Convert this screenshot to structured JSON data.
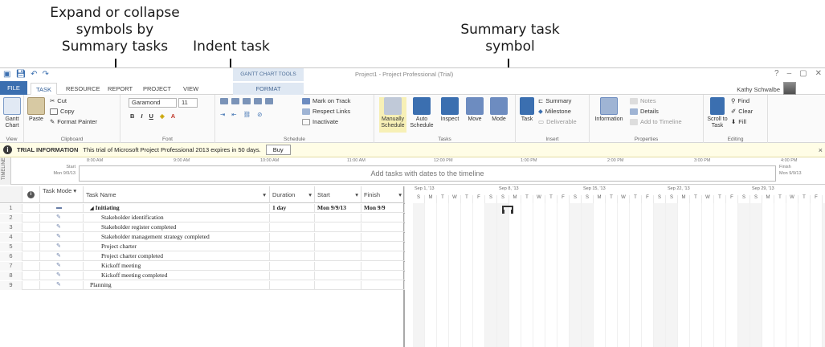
{
  "callouts": {
    "expand": "Expand or collapse\nsymbols by\nSummary tasks",
    "indent": "Indent task",
    "summary": "Summary task\nsymbol"
  },
  "window": {
    "context_tab_group": "GANTT CHART TOOLS",
    "doc_title": "Project1 - Project Professional (Trial)",
    "controls": [
      "?",
      "–",
      "▢",
      "✕"
    ]
  },
  "tabs": [
    "FILE",
    "TASK",
    "RESOURCE",
    "REPORT",
    "PROJECT",
    "VIEW",
    "FORMAT"
  ],
  "active_tab": "TASK",
  "user": "Kathy Schwalbe",
  "ribbon": {
    "view": {
      "btn": "Gantt Chart",
      "label": "View"
    },
    "clipboard": {
      "paste": "Paste",
      "cut": "Cut",
      "copy": "Copy",
      "format_painter": "Format Painter",
      "label": "Clipboard"
    },
    "font": {
      "family": "Garamond",
      "size": "11",
      "label": "Font"
    },
    "schedule": {
      "mark_on_track": "Mark on Track",
      "respect_links": "Respect Links",
      "inactivate": "Inactivate",
      "label": "Schedule"
    },
    "tasks": {
      "manually": "Manually Schedule",
      "auto": "Auto Schedule",
      "inspect": "Inspect",
      "move": "Move",
      "mode": "Mode",
      "label": "Tasks"
    },
    "insert": {
      "task": "Task",
      "summary": "Summary",
      "milestone": "Milestone",
      "deliverable": "Deliverable",
      "label": "Insert"
    },
    "properties": {
      "information": "Information",
      "notes": "Notes",
      "details": "Details",
      "add_to_timeline": "Add to Timeline",
      "label": "Properties"
    },
    "editing": {
      "scroll": "Scroll to Task",
      "find": "Find",
      "clear": "Clear",
      "fill": "Fill",
      "label": "Editing"
    }
  },
  "infobar": {
    "title": "TRIAL INFORMATION",
    "message": "This trial of Microsoft Project Professional 2013 expires in 50 days.",
    "button": "Buy"
  },
  "timeline": {
    "side_label": "TIMELINE",
    "start_label": "Start",
    "start_date": "Mon 9/9/13",
    "finish_label": "Finish",
    "finish_date": "Mon 9/9/13",
    "message": "Add tasks with dates to the timeline",
    "ticks": [
      "8:00 AM",
      "9:00 AM",
      "10:00 AM",
      "11:00 AM",
      "12:00 PM",
      "1:00 PM",
      "2:00 PM",
      "3:00 PM",
      "4:00 PM"
    ]
  },
  "sheet": {
    "headers": {
      "mode": "Task Mode",
      "name": "Task Name",
      "duration": "Duration",
      "start": "Start",
      "finish": "Finish"
    },
    "rows": [
      {
        "num": "1",
        "name": "Initiating",
        "duration": "1 day",
        "start": "Mon 9/9/13",
        "finish": "Mon 9/9",
        "summary": true,
        "indent": 0
      },
      {
        "num": "2",
        "name": "Stakeholder identification",
        "duration": "",
        "start": "",
        "finish": "",
        "summary": false,
        "indent": 1
      },
      {
        "num": "3",
        "name": "Stakeholder register completed",
        "duration": "",
        "start": "",
        "finish": "",
        "summary": false,
        "indent": 1
      },
      {
        "num": "4",
        "name": "Stakeholder management strategy completed",
        "duration": "",
        "start": "",
        "finish": "",
        "summary": false,
        "indent": 1
      },
      {
        "num": "5",
        "name": "Project charter",
        "duration": "",
        "start": "",
        "finish": "",
        "summary": false,
        "indent": 1
      },
      {
        "num": "6",
        "name": "Project charter completed",
        "duration": "",
        "start": "",
        "finish": "",
        "summary": false,
        "indent": 1
      },
      {
        "num": "7",
        "name": "Kickoff meeting",
        "duration": "",
        "start": "",
        "finish": "",
        "summary": false,
        "indent": 1
      },
      {
        "num": "8",
        "name": "Kickoff meeting completed",
        "duration": "",
        "start": "",
        "finish": "",
        "summary": false,
        "indent": 1
      },
      {
        "num": "9",
        "name": "Planning",
        "duration": "",
        "start": "",
        "finish": "",
        "summary": false,
        "indent": 0
      }
    ]
  },
  "gantt": {
    "weeks": [
      "Sep 1, '13",
      "Sep 8, '13",
      "Sep 15, '13",
      "Sep 22, '13",
      "Sep 29, '13",
      "Oct 6, '13"
    ],
    "days": [
      "S",
      "M",
      "T",
      "W",
      "T",
      "F",
      "S"
    ]
  }
}
